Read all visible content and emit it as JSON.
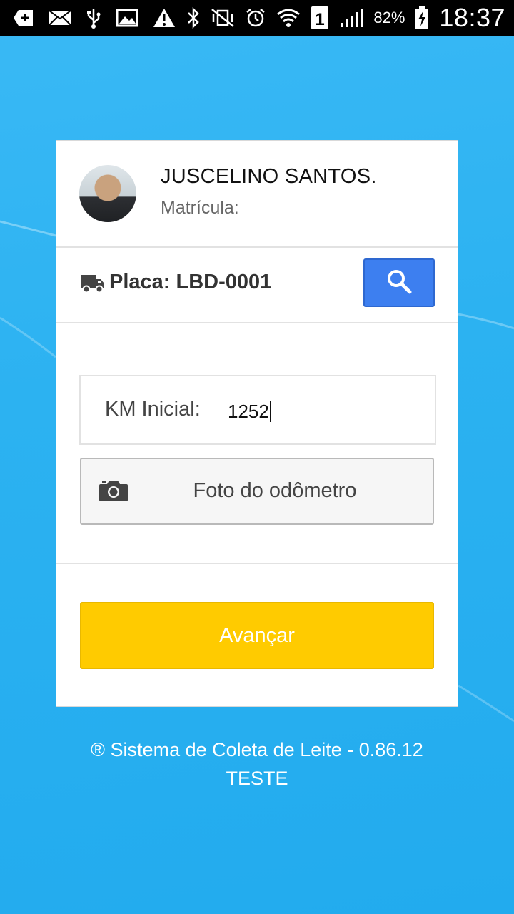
{
  "status_bar": {
    "battery_percent": "82%",
    "clock": "18:37",
    "sim_slot": "1"
  },
  "user": {
    "name": "JUSCELINO SANTOS.",
    "matricula_label": "Matrícula:"
  },
  "vehicle": {
    "plate_text": "Placa: LBD-0001"
  },
  "km_field": {
    "label": "KM Inicial:",
    "value": "1252"
  },
  "photo_button": {
    "label": "Foto do odômetro"
  },
  "advance_button": {
    "label": "Avançar"
  },
  "footer": {
    "line1": "® Sistema de Coleta de Leite - 0.86.12",
    "line2": "TESTE"
  },
  "colors": {
    "background": "#2cb2f1",
    "search_button": "#3d7ff0",
    "advance_button": "#ffcb00"
  }
}
